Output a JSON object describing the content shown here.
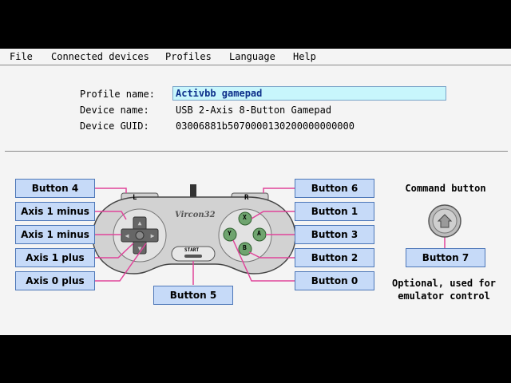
{
  "menu": [
    "File",
    "Connected devices",
    "Profiles",
    "Language",
    "Help"
  ],
  "fields": {
    "profile_label": "Profile name:",
    "profile_value": "Activbb gamepad",
    "device_label": "Device name:",
    "device_value": "USB 2-Axis 8-Button Gamepad",
    "guid_label": "Device GUID:",
    "guid_value": "03006881b5070000130200000000000"
  },
  "left_buttons": [
    "Button 4",
    "Axis 1 minus",
    "Axis 1 minus",
    "Axis 1 plus",
    "Axis 0 plus"
  ],
  "right_buttons": [
    "Button 6",
    "Button 1",
    "Button 3",
    "Button 2",
    "Button 0"
  ],
  "bottom_button": "Button 5",
  "command": {
    "title": "Command button",
    "button": "Button 7",
    "note_line1": "Optional, used for",
    "note_line2": "emulator control"
  },
  "gamepad": {
    "logo": "Vircon32",
    "start_label": "START",
    "shoulder_left": "L",
    "shoulder_right": "R",
    "face_buttons": [
      "X",
      "A",
      "Y",
      "B"
    ]
  },
  "colors": {
    "line": "#e0449a",
    "button_bg": "#c6daf8",
    "input_bg": "#c8f6fc"
  }
}
